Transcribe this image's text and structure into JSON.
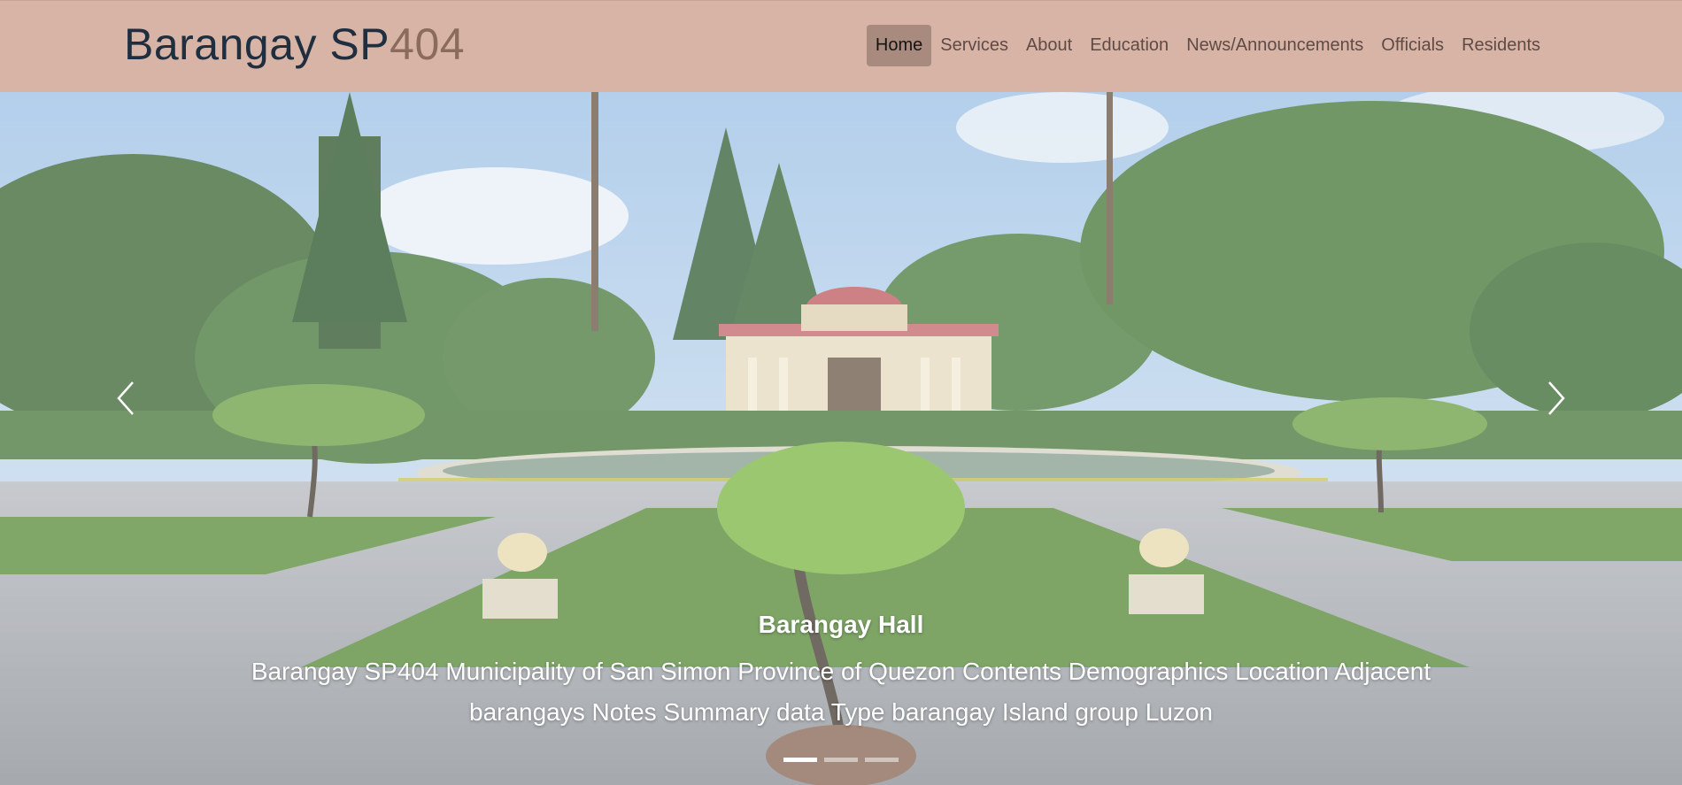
{
  "brand": {
    "part1": "Barangay SP",
    "part2": "404"
  },
  "nav": {
    "items": [
      {
        "label": "Home",
        "active": true
      },
      {
        "label": "Services"
      },
      {
        "label": "About"
      },
      {
        "label": "Education"
      },
      {
        "label": "News/Announcements"
      },
      {
        "label": "Officials"
      },
      {
        "label": "Residents"
      }
    ]
  },
  "carousel": {
    "caption_title": "Barangay Hall",
    "caption_text": "Barangay SP404 Municipality of San Simon Province of Quezon Contents Demographics Location Adjacent barangays Notes Summary data Type barangay Island group Luzon",
    "prev_icon": "chevron-left-icon",
    "next_icon": "chevron-right-icon",
    "slide_count": 3,
    "active_slide": 1
  }
}
